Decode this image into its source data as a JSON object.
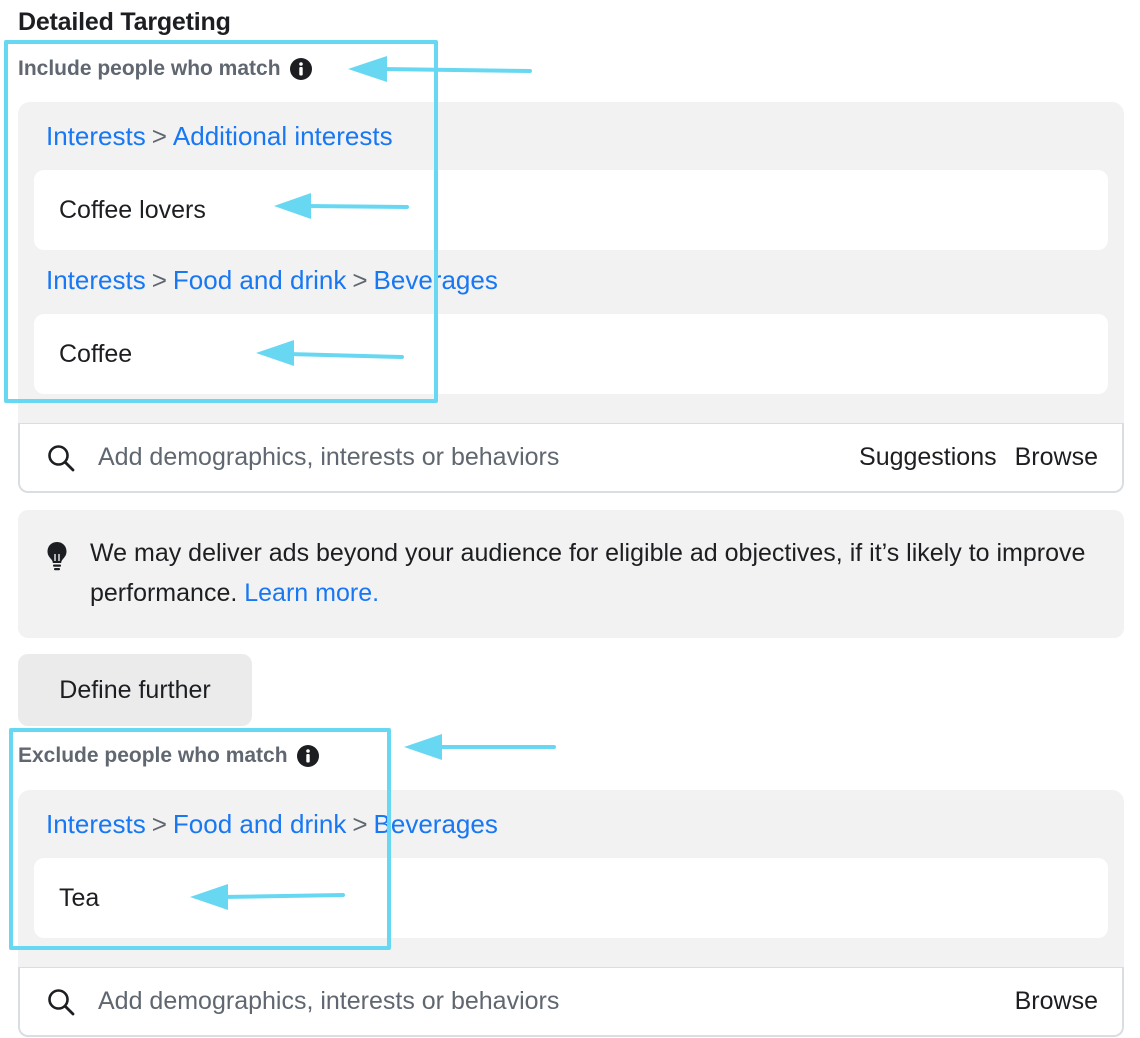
{
  "section_title": "Detailed Targeting",
  "include": {
    "label": "Include people who match",
    "groups": [
      {
        "crumbs": [
          "Interests",
          "Additional interests"
        ],
        "item": "Coffee lovers"
      },
      {
        "crumbs": [
          "Interests",
          "Food and drink",
          "Beverages"
        ],
        "item": "Coffee"
      }
    ],
    "search": {
      "placeholder": "Add demographics, interests or behaviors",
      "suggestions": "Suggestions",
      "browse": "Browse"
    }
  },
  "notice": {
    "text": "We may deliver ads beyond your audience for eligible ad objectives, if it’s likely to improve performance.",
    "link": "Learn more."
  },
  "define_further": "Define further",
  "exclude": {
    "label": "Exclude people who match",
    "groups": [
      {
        "crumbs": [
          "Interests",
          "Food and drink",
          "Beverages"
        ],
        "item": "Tea"
      }
    ],
    "search": {
      "placeholder": "Add demographics, interests or behaviors",
      "browse": "Browse"
    }
  },
  "colors": {
    "link": "#1877f2",
    "highlight": "#68d8f2",
    "panel": "#f2f2f2"
  },
  "icons": [
    "info-icon",
    "search-icon",
    "lightbulb-icon",
    "arrow-annotation"
  ]
}
